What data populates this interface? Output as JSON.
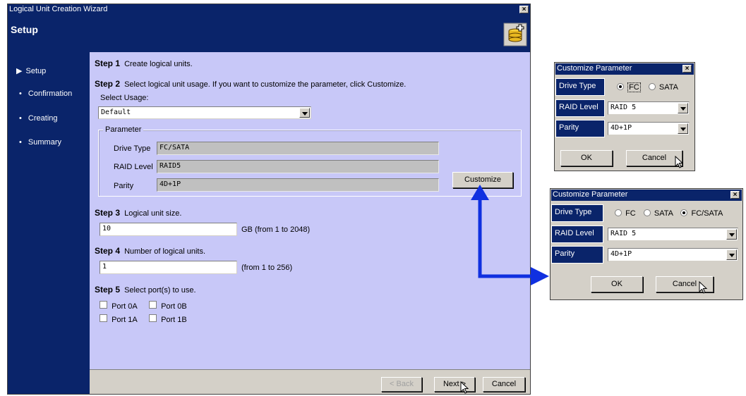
{
  "wizard": {
    "window_title": "Logical Unit Creation Wizard",
    "close_glyph": "×",
    "header_title": "Setup",
    "header_icon": "database-add-icon",
    "sidebar": {
      "items": [
        {
          "label": "Setup",
          "marker": "▶"
        },
        {
          "label": "Confirmation",
          "marker": "•"
        },
        {
          "label": "Creating",
          "marker": "•"
        },
        {
          "label": "Summary",
          "marker": "•"
        }
      ]
    },
    "step1": {
      "num": "Step 1",
      "text": "Create logical units."
    },
    "step2": {
      "num": "Step 2",
      "text": "Select logical unit usage. If you want to customize the parameter, click Customize.",
      "select_label": "Select Usage:",
      "usage_value": "Default",
      "parameter_legend": "Parameter",
      "drive_type_label": "Drive Type",
      "drive_type_value": "FC/SATA",
      "raid_level_label": "RAID Level",
      "raid_level_value": "RAID5",
      "parity_label": "Parity",
      "parity_value": "4D+1P",
      "customize_label": "Customize"
    },
    "step3": {
      "num": "Step 3",
      "text": "Logical unit size.",
      "value": "10",
      "hint": "GB (from 1 to 2048)"
    },
    "step4": {
      "num": "Step 4",
      "text": "Number of logical units.",
      "value": "1",
      "hint": "(from 1 to 256)"
    },
    "step5": {
      "num": "Step 5",
      "text": "Select port(s) to use.",
      "ports": [
        "Port 0A",
        "Port 0B",
        "Port 1A",
        "Port 1B"
      ]
    },
    "buttons": {
      "back": "< Back",
      "next": "Next >",
      "cancel": "Cancel"
    }
  },
  "dialog1": {
    "title": "Customize Parameter",
    "drive_type_label": "Drive Type",
    "radio_fc": "FC",
    "radio_sata": "SATA",
    "selected": "FC",
    "raid_level_label": "RAID Level",
    "raid_level_value": "RAID 5",
    "parity_label": "Parity",
    "parity_value": "4D+1P",
    "ok": "OK",
    "cancel": "Cancel"
  },
  "dialog2": {
    "title": "Customize Parameter",
    "drive_type_label": "Drive Type",
    "radio_fc": "FC",
    "radio_sata": "SATA",
    "radio_fcsata": "FC/SATA",
    "selected": "FC/SATA",
    "raid_level_label": "RAID Level",
    "raid_level_value": "RAID 5",
    "parity_label": "Parity",
    "parity_value": "4D+1P",
    "ok": "OK",
    "cancel": "Cancel"
  },
  "colors": {
    "sidebar": "#0a246a",
    "content": "#c8c8f8",
    "arrow": "#1030e0"
  }
}
